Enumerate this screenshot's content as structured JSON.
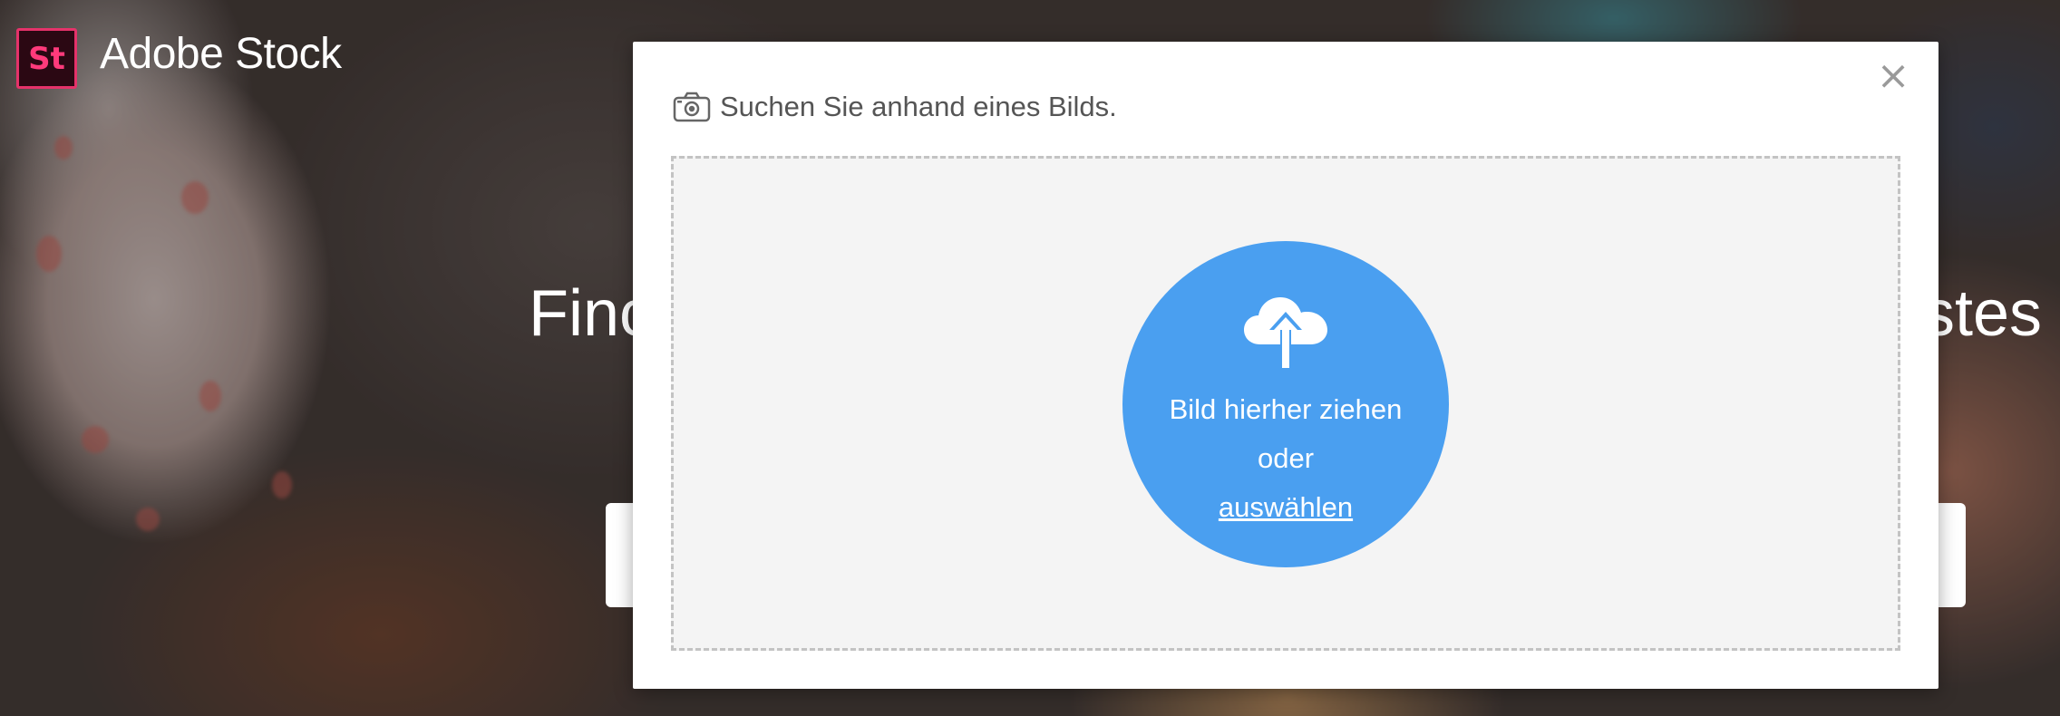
{
  "header": {
    "logo_text": "St",
    "brand_name": "Adobe Stock"
  },
  "hero": {
    "text_left_fragment": "Finc",
    "text_right_fragment": "stes"
  },
  "modal": {
    "title": "Suchen Sie anhand eines Bilds.",
    "close_label": "×",
    "dropzone": {
      "drag_text": "Bild hierher ziehen",
      "or_text": "oder",
      "choose_link": "auswählen"
    }
  },
  "colors": {
    "accent_blue": "#4a9ff0",
    "logo_pink": "#e5326a",
    "logo_bg": "#2b0813"
  },
  "icons": [
    "camera-icon",
    "cloud-upload-icon",
    "close-icon"
  ]
}
